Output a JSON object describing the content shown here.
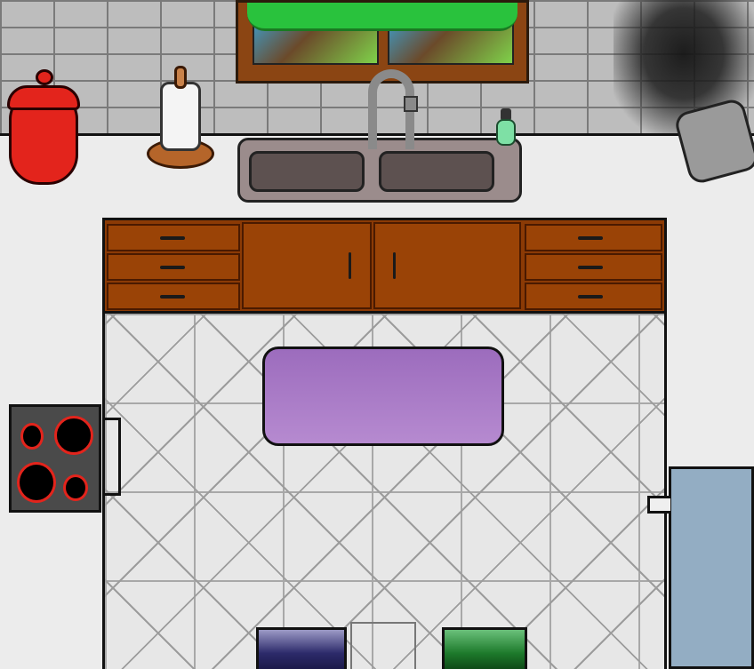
{
  "scene": {
    "colors": {
      "wall": "#bdbdbd",
      "counter": "#ececec",
      "cabinet": "#8b3a05",
      "floor": "#e7e7e7",
      "rug": "#a77ccb",
      "pot": "#e3241c",
      "fridge": "#93adc3",
      "stove": "#4a4a4a",
      "burner_ring": "#e3241c",
      "bin_blue": "#2c2a6a",
      "bin_green": "#1d7a2b",
      "soap": "#7ee0a5",
      "smoke": "#1e1e1e"
    },
    "objects": [
      "window",
      "curtain",
      "pot",
      "paper-towel",
      "sink",
      "faucet",
      "soap-dispenser",
      "toaster",
      "smoke",
      "cabinets",
      "stove",
      "rug",
      "fridge",
      "recycling-bin",
      "clear-bin",
      "compost-bin"
    ],
    "burner_count": 4,
    "drawer_count": 6,
    "door_count": 2
  }
}
